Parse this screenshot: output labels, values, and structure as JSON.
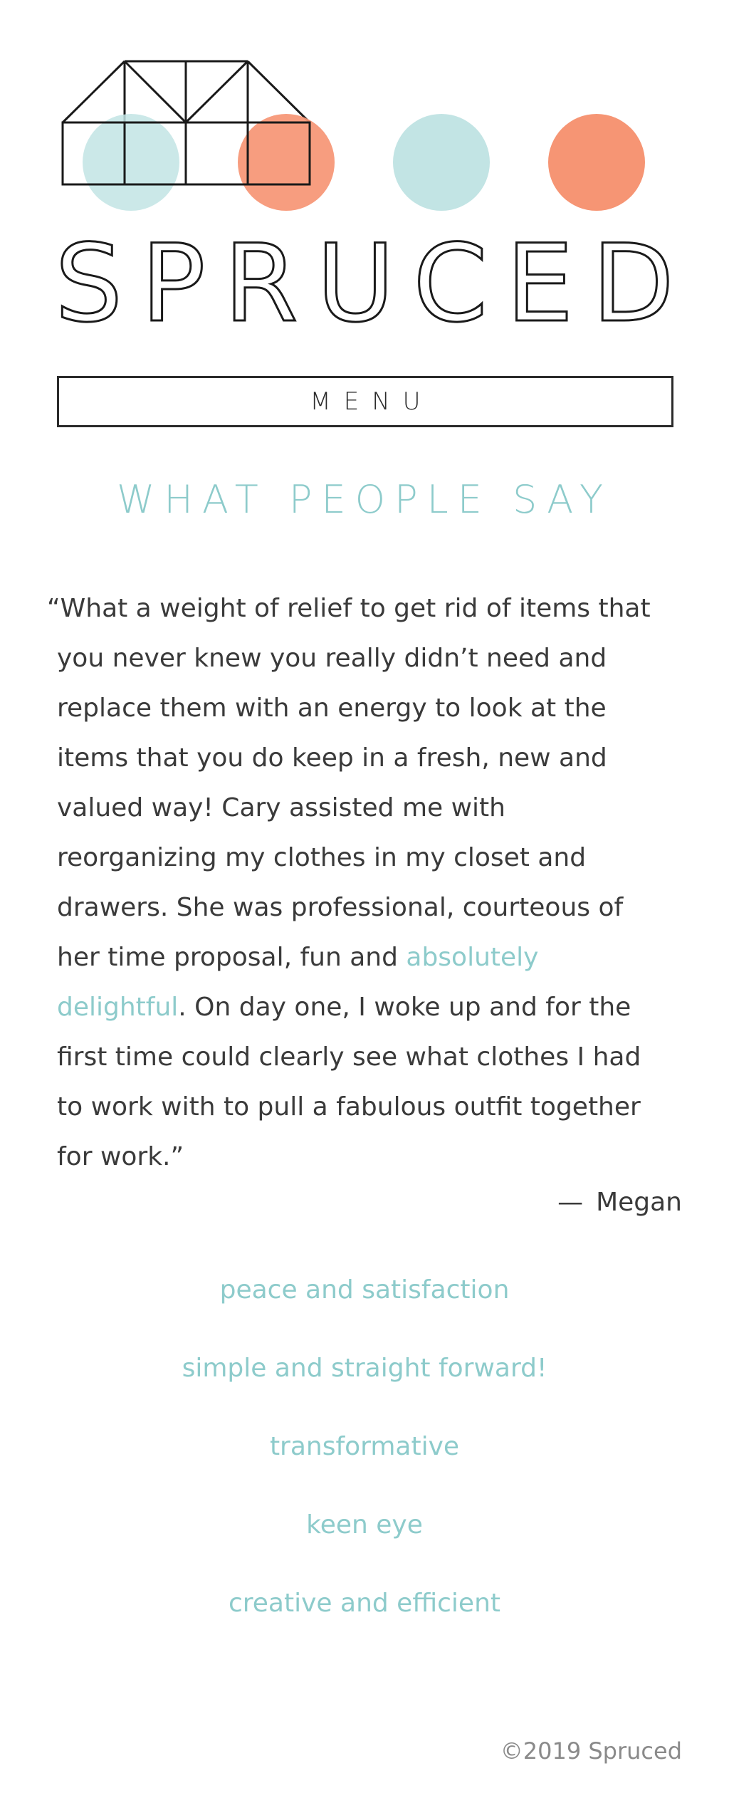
{
  "brand": {
    "name": "SPRUCED",
    "colors": {
      "teal": "#c2e4e4",
      "coral": "#f69574",
      "accent_text": "#8dcbcb",
      "outline": "#1a1a1a"
    }
  },
  "nav": {
    "menu_label": "MENU"
  },
  "section": {
    "title": "WHAT PEOPLE SAY"
  },
  "testimonial": {
    "text_before": "“What a weight of relief to get rid of items that you never knew you really didn’t need and replace them with an energy to look at the items that you do keep in a fresh, new and valued way! Cary assisted me with reorganizing my clothes in my closet and drawers. She was professional, courteous of her time proposal, fun and ",
    "link_text": "absolutely delightful",
    "text_after": ". On day one, I woke up and for the first time could clearly see what clothes I had to work with to pull a fabulous outfit together for work.”",
    "author_dash": "—",
    "author": "Megan"
  },
  "testimonial_links": [
    "peace and satisfaction",
    "simple and straight forward!",
    "transformative",
    "keen eye",
    "creative and efficient"
  ],
  "footer": {
    "copyright": "©2019 Spruced"
  }
}
